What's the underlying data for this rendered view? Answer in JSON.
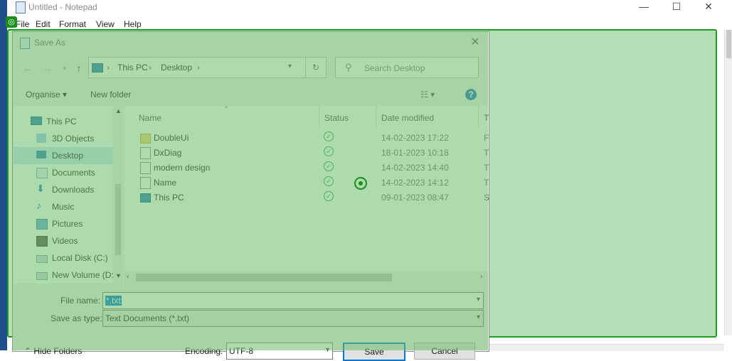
{
  "notepad": {
    "title": "Untitled - Notepad",
    "menu": [
      "File",
      "Edit",
      "Format",
      "View",
      "Help"
    ],
    "controls": {
      "minimize": "—",
      "maximize": "☐",
      "close": "✕"
    }
  },
  "dialog": {
    "title": "Save As",
    "close": "✕",
    "breadcrumb": [
      "This PC",
      "Desktop"
    ],
    "search_placeholder": "Search Desktop",
    "toolbar": {
      "organise": "Organise ▾",
      "new_folder": "New folder",
      "help": "?"
    },
    "nav_items": [
      {
        "label": "This PC",
        "icon": "this-pc-icon"
      },
      {
        "label": "3D Objects",
        "icon": "cube-icon"
      },
      {
        "label": "Desktop",
        "icon": "desktop-icon",
        "selected": true
      },
      {
        "label": "Documents",
        "icon": "documents-icon"
      },
      {
        "label": "Downloads",
        "icon": "download-arrow-icon"
      },
      {
        "label": "Music",
        "icon": "music-note-icon"
      },
      {
        "label": "Pictures",
        "icon": "pictures-icon"
      },
      {
        "label": "Videos",
        "icon": "film-icon"
      },
      {
        "label": "Local Disk (C:)",
        "icon": "drive-icon"
      },
      {
        "label": "New Volume (D:",
        "icon": "drive-icon"
      }
    ],
    "columns": {
      "name": "Name",
      "status": "Status",
      "date": "Date modified",
      "type": "T"
    },
    "files": [
      {
        "name": "DoubleUi",
        "date": "14-02-2023 17:22",
        "type": "F",
        "icon": "folder-icon"
      },
      {
        "name": "DxDiag",
        "date": "18-01-2023 10:18",
        "type": "T",
        "icon": "text-file-icon"
      },
      {
        "name": "modern design",
        "date": "14-02-2023 14:40",
        "type": "T",
        "icon": "text-file-icon"
      },
      {
        "name": "Name",
        "date": "14-02-2023 14:12",
        "type": "T",
        "icon": "text-file-icon"
      },
      {
        "name": "This PC",
        "date": "09-01-2023 08:47",
        "type": "S",
        "icon": "shortcut-icon"
      }
    ],
    "file_name_label": "File name:",
    "file_name_value": "*.txt",
    "save_type_label": "Save as type:",
    "save_type_value": "Text Documents (*.txt)",
    "hide_folders": "Hide Folders",
    "encoding_label": "Encoding:",
    "encoding_value": "UTF-8",
    "save_button": "Save",
    "cancel_button": "Cancel"
  },
  "colors": {
    "overlay": "#6cbe6c",
    "overlay_border": "#1e9a1e",
    "selection": "#0078d7"
  }
}
